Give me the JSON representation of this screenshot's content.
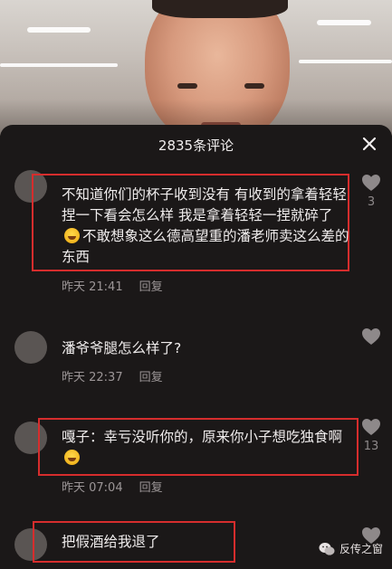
{
  "header": {
    "title": "2835条评论"
  },
  "comments": [
    {
      "text_a": "不知道你们的杯子收到没有 有收到的拿着轻轻捏一下看会怎么样 我是拿着轻轻一捏就碎了",
      "text_b": "不敢想象这么德高望重的潘老师卖这么差的东西",
      "emoji": "laughing-crying-emoji",
      "time": "昨天 21:41",
      "reply": "回复",
      "likes": "3",
      "highlighted": true
    },
    {
      "text": "潘爷爷腿怎么样了?",
      "time": "昨天 22:37",
      "reply": "回复",
      "likes": "",
      "highlighted": false
    },
    {
      "text_a": "嘎子：幸亏没听你的，原来你小子想吃独食啊",
      "emoji": "laughing-crying-emoji",
      "time": "昨天 07:04",
      "reply": "回复",
      "likes": "13",
      "highlighted": true
    },
    {
      "text": "把假酒给我退了",
      "likes": "",
      "highlighted": true
    }
  ],
  "watermark": {
    "text": "反传之窗",
    "icon": "wechat-icon"
  },
  "colors": {
    "sheet": "#1b1818",
    "highlight": "#d62d2d",
    "meta": "#9c9697"
  }
}
